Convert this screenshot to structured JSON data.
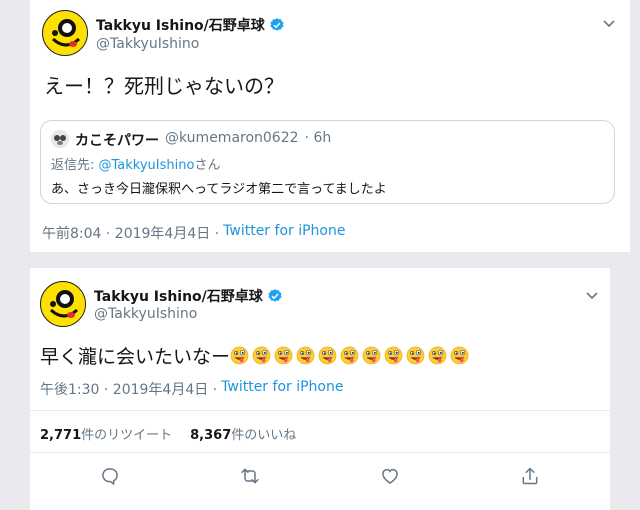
{
  "tweet1": {
    "display_name": "Takkyu Ishino/石野卓球",
    "handle": "@TakkyuIshino",
    "text": "えー！？死刑じゃないの？",
    "quote": {
      "display_name": "カこそパワー",
      "handle": "@kumemaron0622",
      "age": "· 6h",
      "reply_prefix": "返信先: ",
      "reply_to": "@TakkyuIshino",
      "reply_suffix": "さん",
      "text": "あ、さっき今日瀧保釈へってラジオ第二で言ってましたよ"
    },
    "time": "午前8:04 · 2019年4月4日 ·",
    "source": "Twitter for iPhone"
  },
  "tweet2": {
    "display_name": "Takkyu Ishino/石野卓球",
    "handle": "@TakkyuIshino",
    "text": "早く瀧に会いたいなー",
    "emoji_icon": "zany-face-icon",
    "emoji_count": 11,
    "time": "午後1:30 · 2019年4月4日 ·",
    "source": "Twitter for iPhone",
    "retweets_count": "2,771",
    "retweets_label": "件のリツイート",
    "likes_count": "8,367",
    "likes_label": "件のいいね"
  },
  "icons": {
    "verified": "verified-badge-icon",
    "menu": "chevron-down-icon",
    "reply": "reply-icon",
    "retweet": "retweet-icon",
    "like": "heart-icon",
    "share": "share-icon"
  },
  "colors": {
    "verified": "#1da1f2",
    "link": "#1b95e0",
    "muted": "#657786",
    "avatar_yellow": "#ffe100"
  }
}
